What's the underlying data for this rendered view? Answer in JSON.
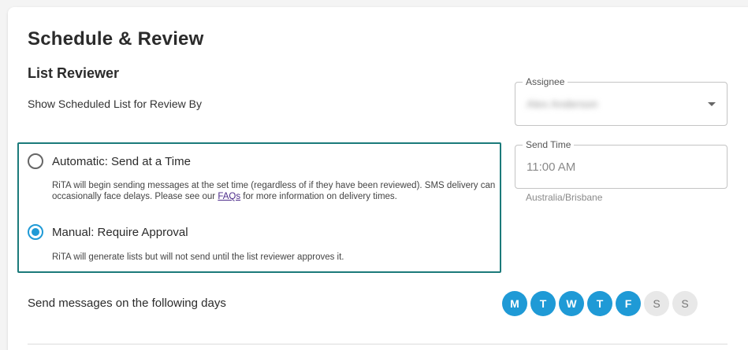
{
  "page": {
    "title": "Schedule & Review"
  },
  "reviewer": {
    "section_title": "List Reviewer",
    "show_label": "Show Scheduled List for Review By",
    "assignee": {
      "label": "Assignee",
      "value": "Alex Anderson"
    },
    "send_time": {
      "label": "Send Time",
      "value": "11:00 AM",
      "timezone": "Australia/Brisbane"
    },
    "options": [
      {
        "label": "Automatic: Send at a Time",
        "selected": false,
        "description_before": "RiTA will begin sending messages at the set time (regardless of if they have been reviewed). SMS delivery can occasionally face delays. Please see our ",
        "link_text": "FAQs",
        "description_after": " for more information on delivery times."
      },
      {
        "label": "Manual: Require Approval",
        "selected": true,
        "description": "RiTA will generate lists but will not send until the list reviewer approves it."
      }
    ],
    "highlight_color": "#1b7a7a",
    "accent_color": "#1f9ad6"
  },
  "days": {
    "label": "Send messages on the following days",
    "items": [
      {
        "letter": "M",
        "active": true
      },
      {
        "letter": "T",
        "active": true
      },
      {
        "letter": "W",
        "active": true
      },
      {
        "letter": "T",
        "active": true
      },
      {
        "letter": "F",
        "active": true
      },
      {
        "letter": "S",
        "active": false
      },
      {
        "letter": "S",
        "active": false
      }
    ]
  }
}
